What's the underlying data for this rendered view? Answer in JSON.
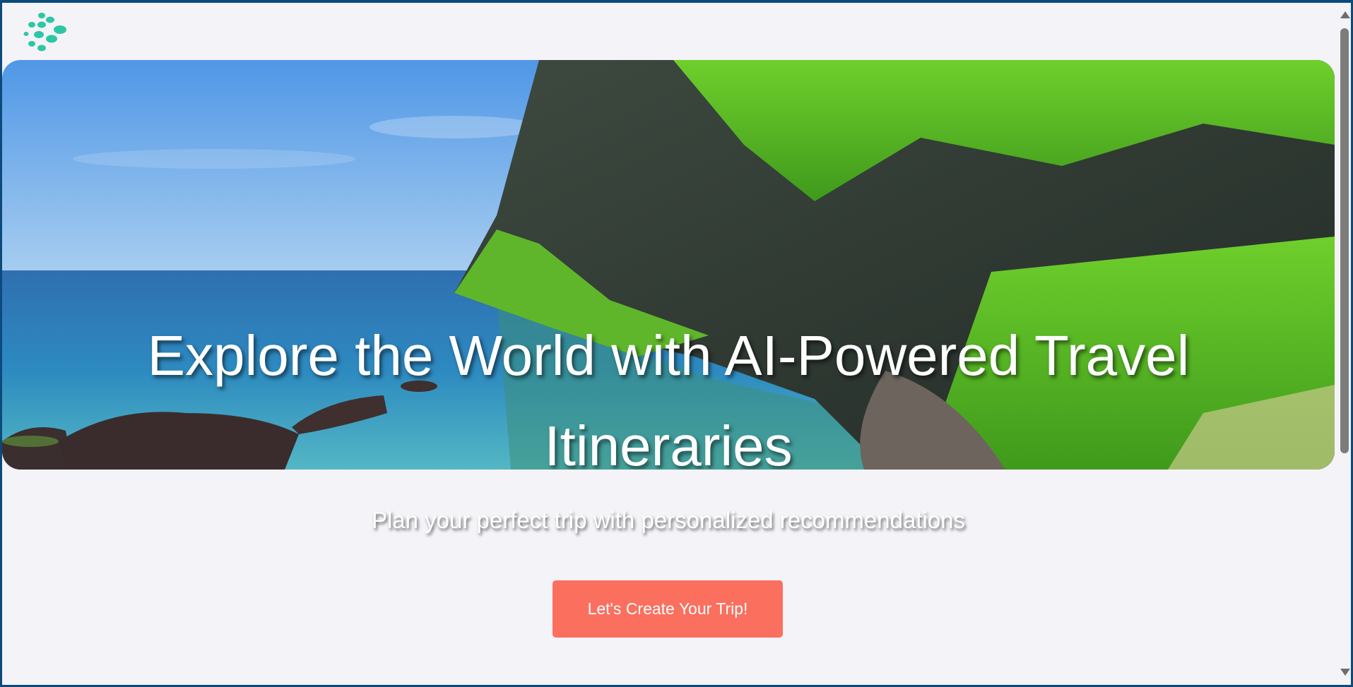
{
  "brand": {
    "logo_icon": "dots-logo-icon",
    "logo_color": "#2cc7a5"
  },
  "hero": {
    "image": "coastal-cliff-landscape",
    "title": "Explore the World with AI-Powered Travel Itineraries",
    "subtitle": "Plan your perfect trip with personalized recommendations"
  },
  "cta": {
    "label": "Let's Create Your Trip!",
    "color": "#fb6f5f"
  },
  "scrollbar": {
    "up_icon": "chevron-up-icon",
    "down_icon": "chevron-down-icon"
  }
}
